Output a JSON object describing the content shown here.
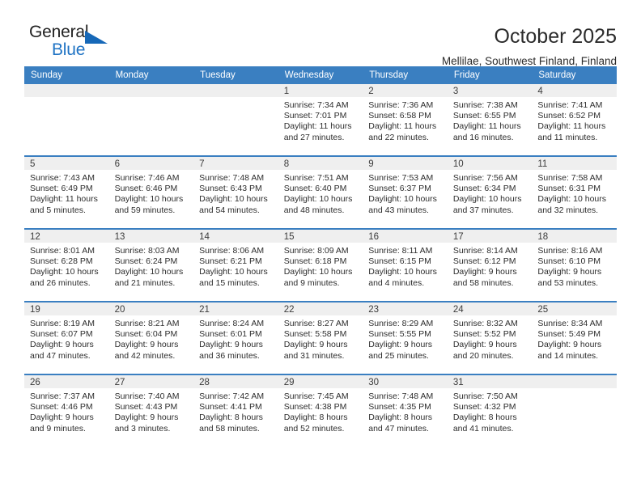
{
  "logo": {
    "text_primary": "General",
    "text_secondary": "Blue",
    "triangle_color": "#1668b8",
    "secondary_color": "#1f73c4"
  },
  "header": {
    "title": "October 2025",
    "subtitle": "Mellilae, Southwest Finland, Finland"
  },
  "theme": {
    "header_band": "#3a7fc1",
    "daynum_band": "#efefef",
    "text": "#2d2d2d"
  },
  "weekdays": [
    "Sunday",
    "Monday",
    "Tuesday",
    "Wednesday",
    "Thursday",
    "Friday",
    "Saturday"
  ],
  "weeks": [
    [
      {
        "day": "",
        "empty": true
      },
      {
        "day": "",
        "empty": true
      },
      {
        "day": "",
        "empty": true
      },
      {
        "day": "1",
        "sunrise": "Sunrise: 7:34 AM",
        "sunset": "Sunset: 7:01 PM",
        "daylight": "Daylight: 11 hours and 27 minutes."
      },
      {
        "day": "2",
        "sunrise": "Sunrise: 7:36 AM",
        "sunset": "Sunset: 6:58 PM",
        "daylight": "Daylight: 11 hours and 22 minutes."
      },
      {
        "day": "3",
        "sunrise": "Sunrise: 7:38 AM",
        "sunset": "Sunset: 6:55 PM",
        "daylight": "Daylight: 11 hours and 16 minutes."
      },
      {
        "day": "4",
        "sunrise": "Sunrise: 7:41 AM",
        "sunset": "Sunset: 6:52 PM",
        "daylight": "Daylight: 11 hours and 11 minutes."
      }
    ],
    [
      {
        "day": "5",
        "sunrise": "Sunrise: 7:43 AM",
        "sunset": "Sunset: 6:49 PM",
        "daylight": "Daylight: 11 hours and 5 minutes."
      },
      {
        "day": "6",
        "sunrise": "Sunrise: 7:46 AM",
        "sunset": "Sunset: 6:46 PM",
        "daylight": "Daylight: 10 hours and 59 minutes."
      },
      {
        "day": "7",
        "sunrise": "Sunrise: 7:48 AM",
        "sunset": "Sunset: 6:43 PM",
        "daylight": "Daylight: 10 hours and 54 minutes."
      },
      {
        "day": "8",
        "sunrise": "Sunrise: 7:51 AM",
        "sunset": "Sunset: 6:40 PM",
        "daylight": "Daylight: 10 hours and 48 minutes."
      },
      {
        "day": "9",
        "sunrise": "Sunrise: 7:53 AM",
        "sunset": "Sunset: 6:37 PM",
        "daylight": "Daylight: 10 hours and 43 minutes."
      },
      {
        "day": "10",
        "sunrise": "Sunrise: 7:56 AM",
        "sunset": "Sunset: 6:34 PM",
        "daylight": "Daylight: 10 hours and 37 minutes."
      },
      {
        "day": "11",
        "sunrise": "Sunrise: 7:58 AM",
        "sunset": "Sunset: 6:31 PM",
        "daylight": "Daylight: 10 hours and 32 minutes."
      }
    ],
    [
      {
        "day": "12",
        "sunrise": "Sunrise: 8:01 AM",
        "sunset": "Sunset: 6:28 PM",
        "daylight": "Daylight: 10 hours and 26 minutes."
      },
      {
        "day": "13",
        "sunrise": "Sunrise: 8:03 AM",
        "sunset": "Sunset: 6:24 PM",
        "daylight": "Daylight: 10 hours and 21 minutes."
      },
      {
        "day": "14",
        "sunrise": "Sunrise: 8:06 AM",
        "sunset": "Sunset: 6:21 PM",
        "daylight": "Daylight: 10 hours and 15 minutes."
      },
      {
        "day": "15",
        "sunrise": "Sunrise: 8:09 AM",
        "sunset": "Sunset: 6:18 PM",
        "daylight": "Daylight: 10 hours and 9 minutes."
      },
      {
        "day": "16",
        "sunrise": "Sunrise: 8:11 AM",
        "sunset": "Sunset: 6:15 PM",
        "daylight": "Daylight: 10 hours and 4 minutes."
      },
      {
        "day": "17",
        "sunrise": "Sunrise: 8:14 AM",
        "sunset": "Sunset: 6:12 PM",
        "daylight": "Daylight: 9 hours and 58 minutes."
      },
      {
        "day": "18",
        "sunrise": "Sunrise: 8:16 AM",
        "sunset": "Sunset: 6:10 PM",
        "daylight": "Daylight: 9 hours and 53 minutes."
      }
    ],
    [
      {
        "day": "19",
        "sunrise": "Sunrise: 8:19 AM",
        "sunset": "Sunset: 6:07 PM",
        "daylight": "Daylight: 9 hours and 47 minutes."
      },
      {
        "day": "20",
        "sunrise": "Sunrise: 8:21 AM",
        "sunset": "Sunset: 6:04 PM",
        "daylight": "Daylight: 9 hours and 42 minutes."
      },
      {
        "day": "21",
        "sunrise": "Sunrise: 8:24 AM",
        "sunset": "Sunset: 6:01 PM",
        "daylight": "Daylight: 9 hours and 36 minutes."
      },
      {
        "day": "22",
        "sunrise": "Sunrise: 8:27 AM",
        "sunset": "Sunset: 5:58 PM",
        "daylight": "Daylight: 9 hours and 31 minutes."
      },
      {
        "day": "23",
        "sunrise": "Sunrise: 8:29 AM",
        "sunset": "Sunset: 5:55 PM",
        "daylight": "Daylight: 9 hours and 25 minutes."
      },
      {
        "day": "24",
        "sunrise": "Sunrise: 8:32 AM",
        "sunset": "Sunset: 5:52 PM",
        "daylight": "Daylight: 9 hours and 20 minutes."
      },
      {
        "day": "25",
        "sunrise": "Sunrise: 8:34 AM",
        "sunset": "Sunset: 5:49 PM",
        "daylight": "Daylight: 9 hours and 14 minutes."
      }
    ],
    [
      {
        "day": "26",
        "sunrise": "Sunrise: 7:37 AM",
        "sunset": "Sunset: 4:46 PM",
        "daylight": "Daylight: 9 hours and 9 minutes."
      },
      {
        "day": "27",
        "sunrise": "Sunrise: 7:40 AM",
        "sunset": "Sunset: 4:43 PM",
        "daylight": "Daylight: 9 hours and 3 minutes."
      },
      {
        "day": "28",
        "sunrise": "Sunrise: 7:42 AM",
        "sunset": "Sunset: 4:41 PM",
        "daylight": "Daylight: 8 hours and 58 minutes."
      },
      {
        "day": "29",
        "sunrise": "Sunrise: 7:45 AM",
        "sunset": "Sunset: 4:38 PM",
        "daylight": "Daylight: 8 hours and 52 minutes."
      },
      {
        "day": "30",
        "sunrise": "Sunrise: 7:48 AM",
        "sunset": "Sunset: 4:35 PM",
        "daylight": "Daylight: 8 hours and 47 minutes."
      },
      {
        "day": "31",
        "sunrise": "Sunrise: 7:50 AM",
        "sunset": "Sunset: 4:32 PM",
        "daylight": "Daylight: 8 hours and 41 minutes."
      },
      {
        "day": "",
        "empty": true
      }
    ]
  ]
}
